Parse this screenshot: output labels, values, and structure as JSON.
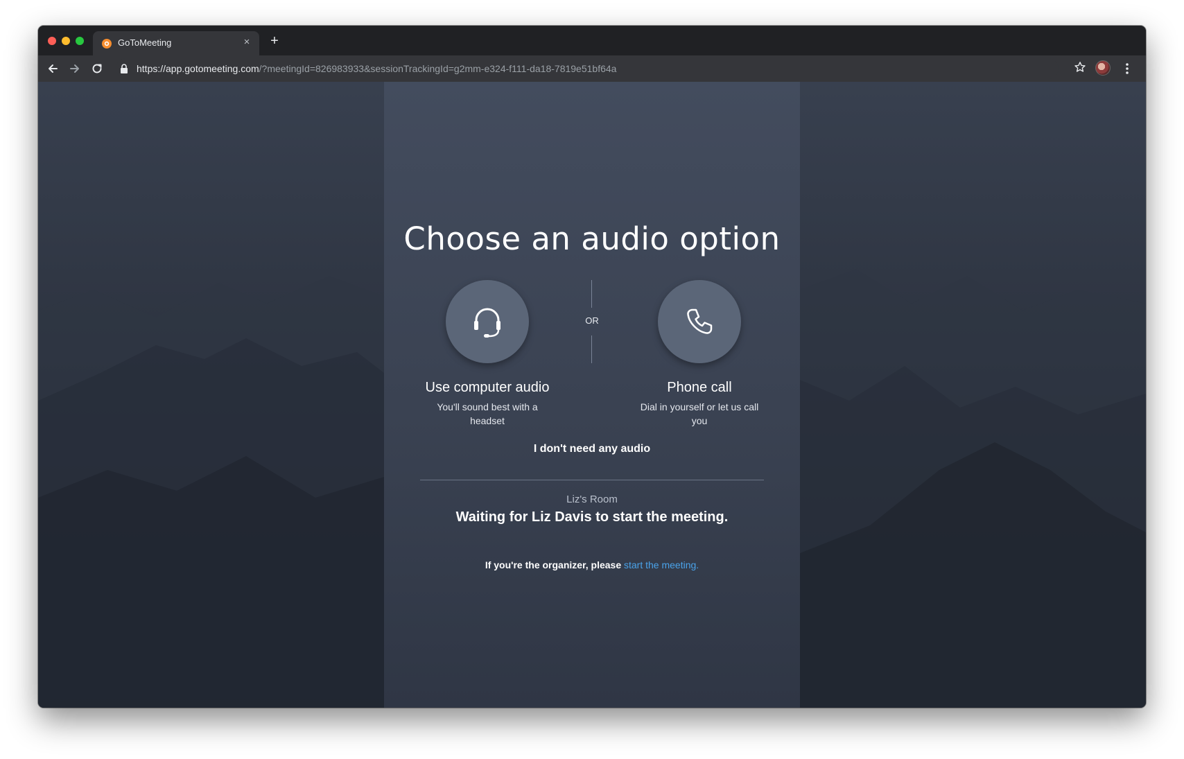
{
  "browser": {
    "tab_title": "GoToMeeting",
    "tab_close": "×",
    "new_tab": "+",
    "url_host": "https://app.gotomeeting.com",
    "url_rest": "/?meetingId=826983933&sessionTrackingId=g2mm-e324-f111-da18-7819e51bf64a"
  },
  "audio": {
    "heading": "Choose an audio option",
    "or_label": "OR",
    "computer_title": "Use computer audio",
    "computer_subtitle": "You'll sound best with a headset",
    "phone_title": "Phone call",
    "phone_subtitle": "Dial in yourself or let us call you",
    "no_audio": "I don't need any audio"
  },
  "meeting": {
    "room_name": "Liz's Room",
    "waiting_text": "Waiting for Liz Davis to start the meeting.",
    "organizer_prefix": "If you're the organizer, please ",
    "organizer_link": "start the meeting."
  },
  "colors": {
    "link": "#4aa3ea",
    "circle": "#5b6678"
  }
}
